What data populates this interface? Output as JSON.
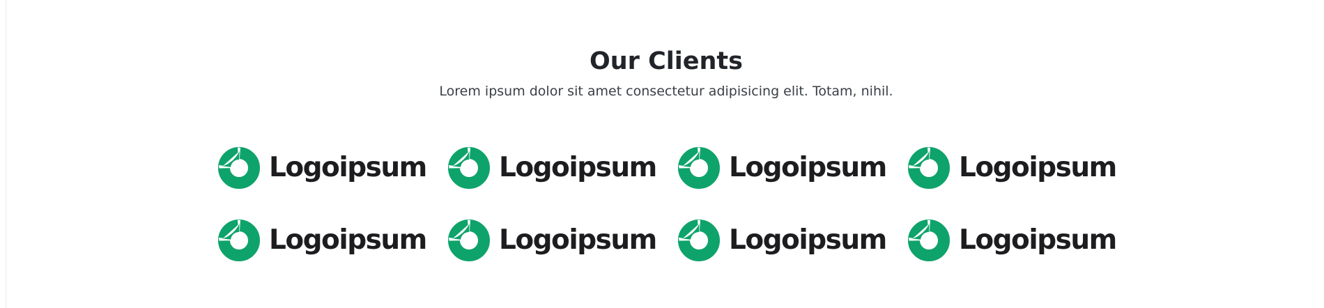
{
  "section": {
    "title": "Our Clients",
    "subtitle": "Lorem ipsum dolor sit amet consectetur adipisicing elit. Totam, nihil."
  },
  "clients": [
    {
      "name": "Logoipsum",
      "icon": "logoipsum-logo-icon"
    },
    {
      "name": "Logoipsum",
      "icon": "logoipsum-logo-icon"
    },
    {
      "name": "Logoipsum",
      "icon": "logoipsum-logo-icon"
    },
    {
      "name": "Logoipsum",
      "icon": "logoipsum-logo-icon"
    },
    {
      "name": "Logoipsum",
      "icon": "logoipsum-logo-icon"
    },
    {
      "name": "Logoipsum",
      "icon": "logoipsum-logo-icon"
    },
    {
      "name": "Logoipsum",
      "icon": "logoipsum-logo-icon"
    },
    {
      "name": "Logoipsum",
      "icon": "logoipsum-logo-icon"
    }
  ],
  "colors": {
    "brand_green": "#0ea36b",
    "heading_text": "#212529",
    "logo_text": "#1d1d20",
    "background": "#ffffff"
  }
}
